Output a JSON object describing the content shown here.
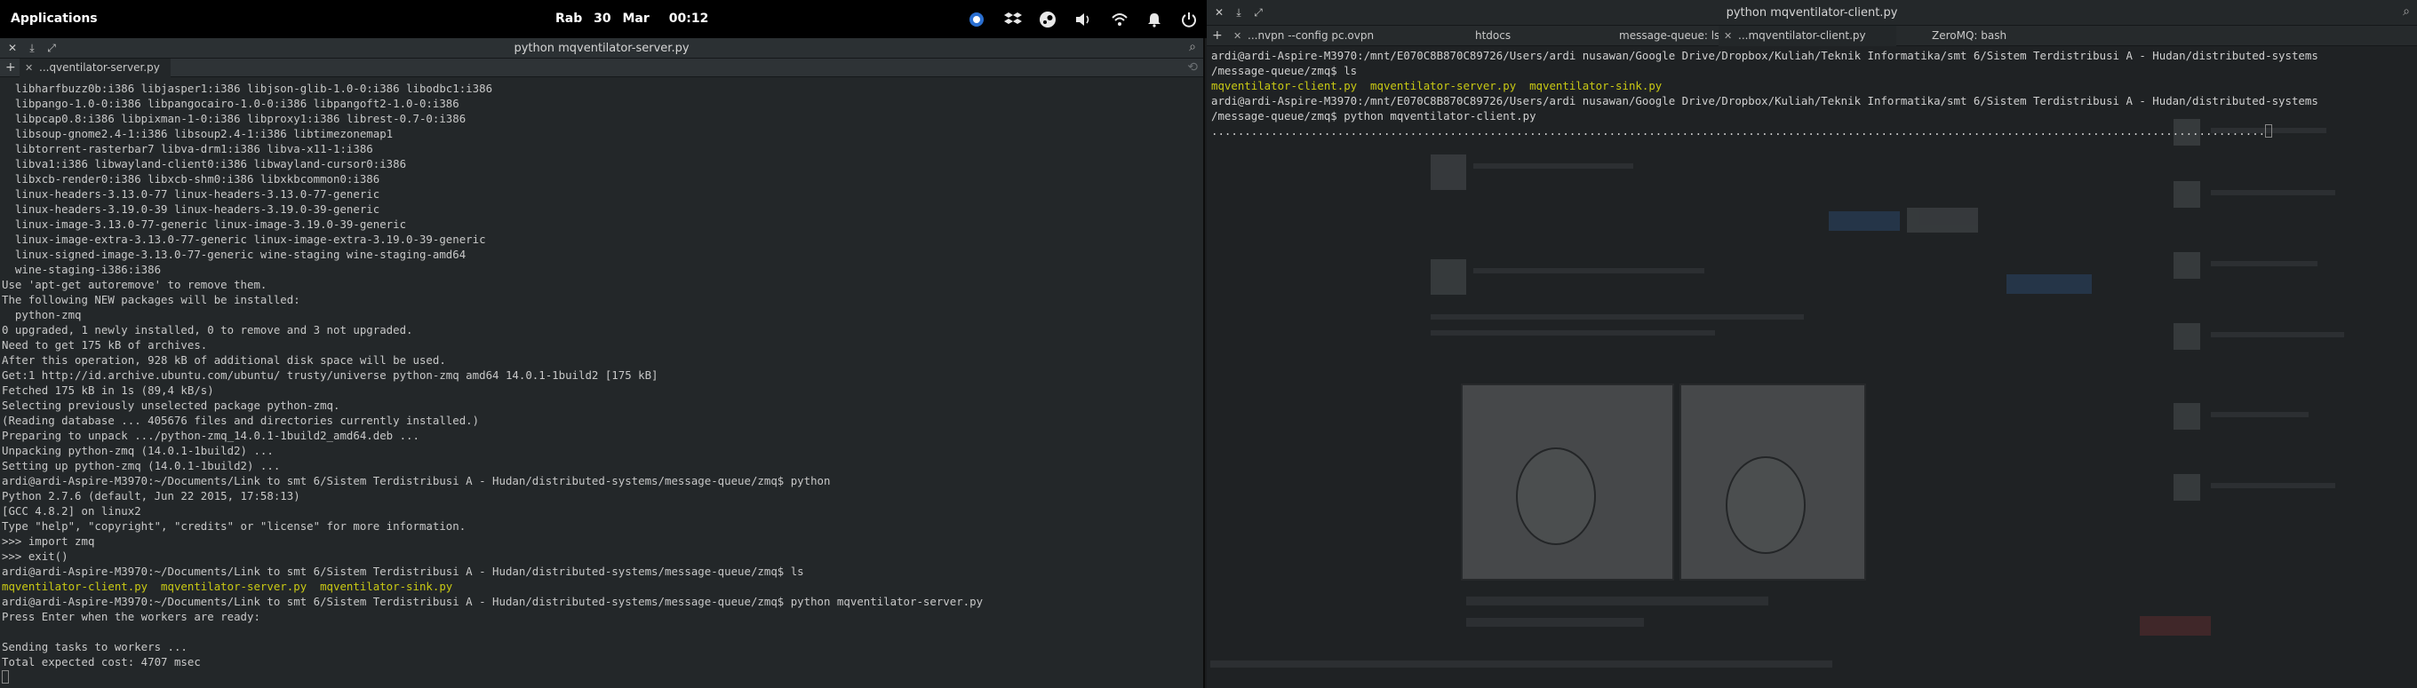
{
  "panel": {
    "applications_label": "Applications",
    "clock_day": "Rab 30 Mar",
    "clock_time": "00:12",
    "tray_icons": [
      "copyq-icon",
      "dropbox-icon",
      "steam-icon",
      "volume-icon",
      "wifi-icon",
      "bell-icon",
      "power-icon"
    ]
  },
  "left_terminal": {
    "title": "python mqventilator-server.py",
    "tab_label": "...qventilator-server.py",
    "lines": [
      {
        "text": "  libharfbuzz0b:i386 libjasper1:i386 libjson-glib-1.0-0:i386 libodbc1:i386",
        "style": "n"
      },
      {
        "text": "  libpango-1.0-0:i386 libpangocairo-1.0-0:i386 libpangoft2-1.0-0:i386",
        "style": "n"
      },
      {
        "text": "  libpcap0.8:i386 libpixman-1-0:i386 libproxy1:i386 librest-0.7-0:i386",
        "style": "n"
      },
      {
        "text": "  libsoup-gnome2.4-1:i386 libsoup2.4-1:i386 libtimezonemap1",
        "style": "n"
      },
      {
        "text": "  libtorrent-rasterbar7 libva-drm1:i386 libva-x11-1:i386",
        "style": "n"
      },
      {
        "text": "  libva1:i386 libwayland-client0:i386 libwayland-cursor0:i386",
        "style": "n"
      },
      {
        "text": "  libxcb-render0:i386 libxcb-shm0:i386 libxkbcommon0:i386",
        "style": "n"
      },
      {
        "text": "  linux-headers-3.13.0-77 linux-headers-3.13.0-77-generic",
        "style": "n"
      },
      {
        "text": "  linux-headers-3.19.0-39 linux-headers-3.19.0-39-generic",
        "style": "n"
      },
      {
        "text": "  linux-image-3.13.0-77-generic linux-image-3.19.0-39-generic",
        "style": "n"
      },
      {
        "text": "  linux-image-extra-3.13.0-77-generic linux-image-extra-3.19.0-39-generic",
        "style": "n"
      },
      {
        "text": "  linux-signed-image-3.13.0-77-generic wine-staging wine-staging-amd64",
        "style": "n"
      },
      {
        "text": "  wine-staging-i386:i386",
        "style": "n"
      },
      {
        "text": "Use 'apt-get autoremove' to remove them.",
        "style": "n"
      },
      {
        "text": "The following NEW packages will be installed:",
        "style": "n"
      },
      {
        "text": "  python-zmq",
        "style": "n"
      },
      {
        "text": "0 upgraded, 1 newly installed, 0 to remove and 3 not upgraded.",
        "style": "n"
      },
      {
        "text": "Need to get 175 kB of archives.",
        "style": "n"
      },
      {
        "text": "After this operation, 928 kB of additional disk space will be used.",
        "style": "n"
      },
      {
        "text": "Get:1 http://id.archive.ubuntu.com/ubuntu/ trusty/universe python-zmq amd64 14.0.1-1build2 [175 kB]",
        "style": "n"
      },
      {
        "text": "Fetched 175 kB in 1s (89,4 kB/s)",
        "style": "n"
      },
      {
        "text": "Selecting previously unselected package python-zmq.",
        "style": "n"
      },
      {
        "text": "(Reading database ... 405676 files and directories currently installed.)",
        "style": "n"
      },
      {
        "text": "Preparing to unpack .../python-zmq_14.0.1-1build2_amd64.deb ...",
        "style": "n"
      },
      {
        "text": "Unpacking python-zmq (14.0.1-1build2) ...",
        "style": "n"
      },
      {
        "text": "Setting up python-zmq (14.0.1-1build2) ...",
        "style": "n"
      },
      {
        "text": "ardi@ardi-Aspire-M3970:~/Documents/Link to smt 6/Sistem Terdistribusi A - Hudan/distributed-systems/message-queue/zmq$ python",
        "style": "n"
      },
      {
        "text": "Python 2.7.6 (default, Jun 22 2015, 17:58:13)",
        "style": "n"
      },
      {
        "text": "[GCC 4.8.2] on linux2",
        "style": "n"
      },
      {
        "text": "Type \"help\", \"copyright\", \"credits\" or \"license\" for more information.",
        "style": "n"
      },
      {
        "text": ">>> import zmq",
        "style": "n"
      },
      {
        "text": ">>> exit()",
        "style": "n"
      },
      {
        "text": "ardi@ardi-Aspire-M3970:~/Documents/Link to smt 6/Sistem Terdistribusi A - Hudan/distributed-systems/message-queue/zmq$ ls",
        "style": "n"
      },
      {
        "text": "mqventilator-client.py  mqventilator-server.py  mqventilator-sink.py",
        "style": "y"
      },
      {
        "text": "ardi@ardi-Aspire-M3970:~/Documents/Link to smt 6/Sistem Terdistribusi A - Hudan/distributed-systems/message-queue/zmq$ python mqventilator-server.py",
        "style": "n"
      },
      {
        "text": "Press Enter when the workers are ready:",
        "style": "n"
      },
      {
        "text": "",
        "style": "n"
      },
      {
        "text": "Sending tasks to workers ...",
        "style": "n"
      },
      {
        "text": "Total expected cost: 4707 msec",
        "style": "n"
      }
    ]
  },
  "right_terminal": {
    "title": "python mqventilator-client.py",
    "tabs": [
      {
        "label": "...nvpn --config pc.ovpn"
      },
      {
        "label": "htdocs"
      },
      {
        "label": "message-queue: ls"
      },
      {
        "label": "...mqventilator-client.py"
      },
      {
        "label": "ZeroMQ: bash"
      }
    ],
    "lines": [
      {
        "text": "ardi@ardi-Aspire-M3970:/mnt/E070C8B870C89726/Users/ardi nusawan/Google Drive/Dropbox/Kuliah/Teknik Informatika/smt 6/Sistem Terdistribusi A - Hudan/distributed-systems",
        "style": "n"
      },
      {
        "text": "/message-queue/zmq$ ls",
        "style": "n"
      },
      {
        "text": "mqventilator-client.py  mqventilator-server.py  mqventilator-sink.py",
        "style": "y"
      },
      {
        "text": "ardi@ardi-Aspire-M3970:/mnt/E070C8B870C89726/Users/ardi nusawan/Google Drive/Dropbox/Kuliah/Teknik Informatika/smt 6/Sistem Terdistribusi A - Hudan/distributed-systems",
        "style": "n"
      },
      {
        "text": "/message-queue/zmq$ python mqventilator-client.py",
        "style": "n"
      },
      {
        "text": "...............................................................................................................................................................",
        "style": "n"
      }
    ]
  }
}
